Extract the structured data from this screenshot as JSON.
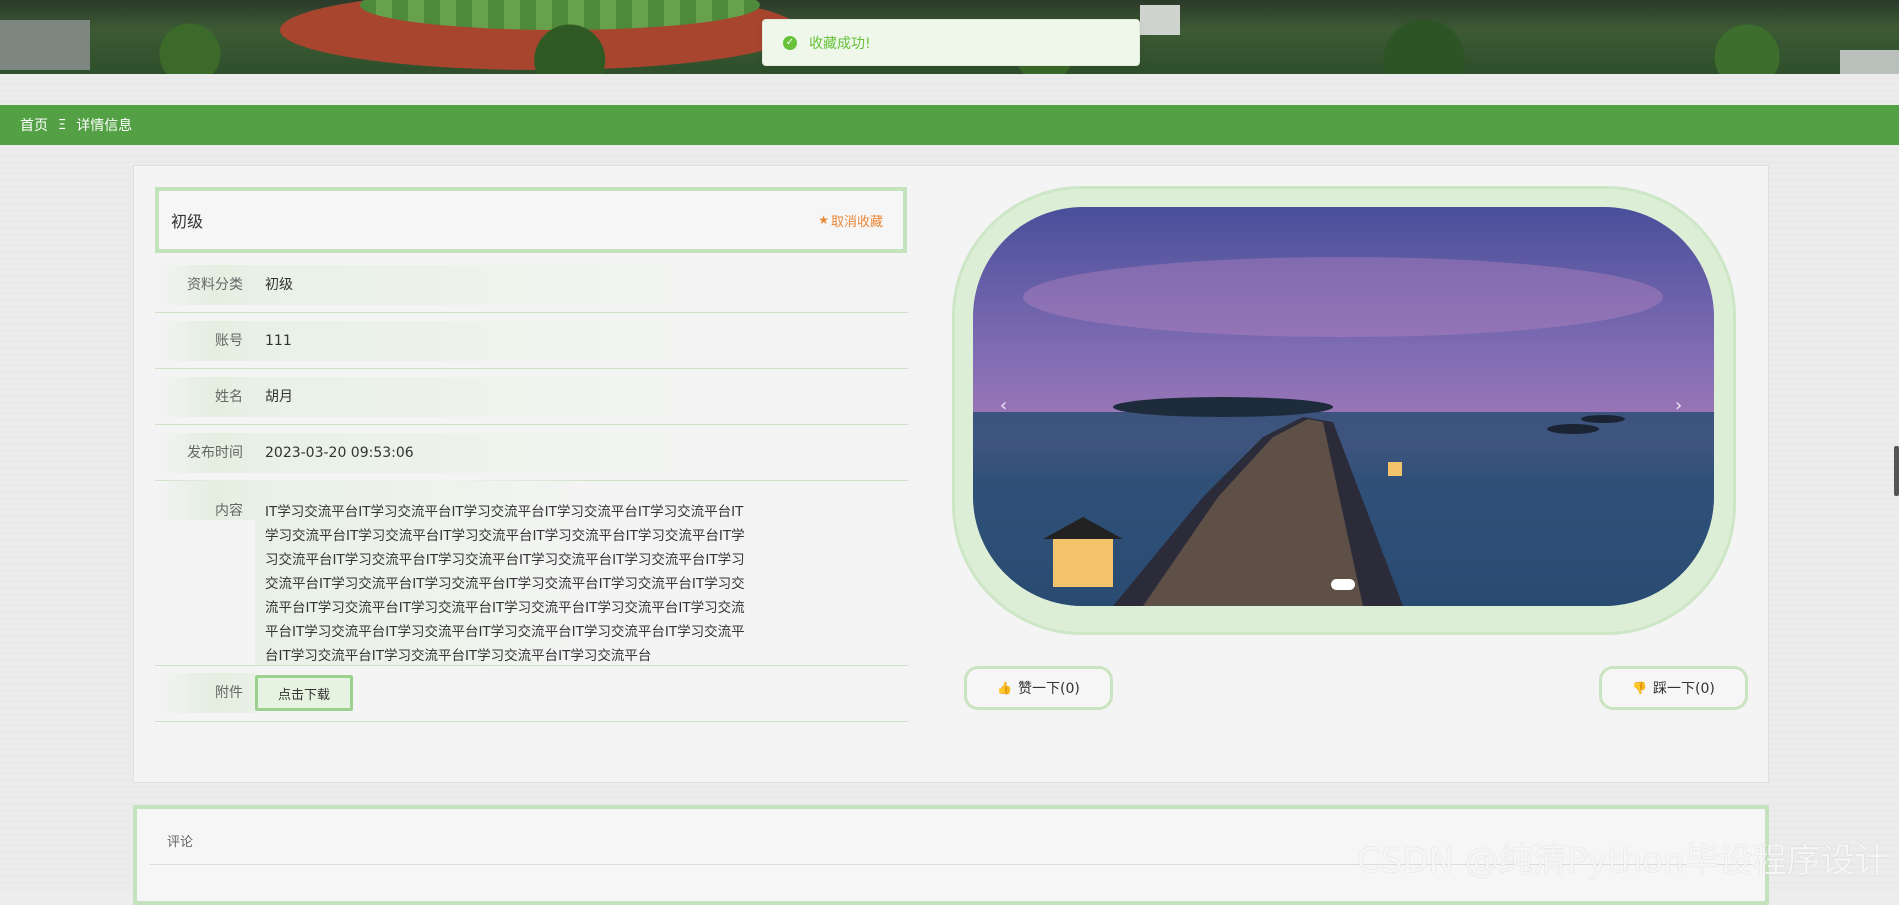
{
  "toast": {
    "icon": "check-circle-icon",
    "message": "收藏成功!"
  },
  "breadcrumb": {
    "home": "首页",
    "separator": "Ξ",
    "current": "详情信息"
  },
  "detail": {
    "title": "初级",
    "favorite_label": "取消收藏",
    "fields": [
      {
        "label": "资料分类",
        "value": "初级"
      },
      {
        "label": "账号",
        "value": "111"
      },
      {
        "label": "姓名",
        "value": "胡月"
      },
      {
        "label": "发布时间",
        "value": "2023-03-20 09:53:06"
      }
    ],
    "content_label": "内容",
    "content": "IT学习交流平台IT学习交流平台IT学习交流平台IT学习交流平台IT学习交流平台IT学习交流平台IT学习交流平台IT学习交流平台IT学习交流平台IT学习交流平台IT学习交流平台IT学习交流平台IT学习交流平台IT学习交流平台IT学习交流平台IT学习交流平台IT学习交流平台IT学习交流平台IT学习交流平台IT学习交流平台IT学习交流平台IT学习交流平台IT学习交流平台IT学习交流平台IT学习交流平台IT学习交流平台IT学习交流平台IT学习交流平台IT学习交流平台IT学习交流平台IT学习交流平台IT学习交流平台IT学习交流平台IT学习交流平台IT学习交流平台",
    "attachment_label": "附件",
    "download_label": "点击下载"
  },
  "carousel": {
    "prev": "‹",
    "next": "›",
    "slides": 1,
    "active": 1
  },
  "votes": {
    "like_label": "赞一下(0)",
    "dislike_label": "踩一下(0)"
  },
  "comments": {
    "header": "评论"
  },
  "watermark": "CSDN @纯清Python毕设程序设计"
}
